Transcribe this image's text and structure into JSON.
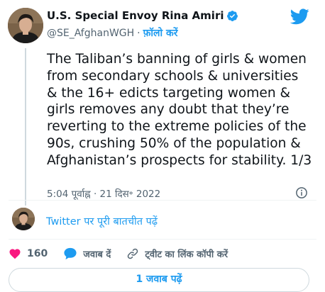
{
  "author": {
    "name": "U.S. Special Envoy Rina Amiri",
    "handle": "@SE_AfghanWGH",
    "separator": "·",
    "follow_label": "फ़ॉलो करें"
  },
  "tweet": {
    "lines": [
      "The Taliban’s banning of girls & women",
      "from secondary schools & universities",
      "& the 16+ edicts targeting women &",
      "girls removes any doubt that they’re",
      "reverting to the extreme policies of the",
      "90s, crushing 50% of the population &",
      "Afghanistan’s prospects for stability. 1/3"
    ],
    "timestamp": "5:04 पूर्वाह्न · 21 दिस॰ 2022"
  },
  "conversation_link": "Twitter पर पूरी बातचीत पढ़ें",
  "actions": {
    "like_count": "160",
    "reply_label": "जवाब दें",
    "copy_link_label": "ट्वीट का लिंक कॉपी करें"
  },
  "read_replies_label": "1 जवाब पढ़ें",
  "colors": {
    "accent": "#1d9bf0",
    "like": "#f91880",
    "text": "#0f1419",
    "muted": "#536471",
    "border": "#cfd9de"
  },
  "icons": [
    "twitter-bird-icon",
    "verified-badge-icon",
    "info-icon",
    "heart-icon",
    "reply-bubble-icon",
    "link-icon"
  ]
}
